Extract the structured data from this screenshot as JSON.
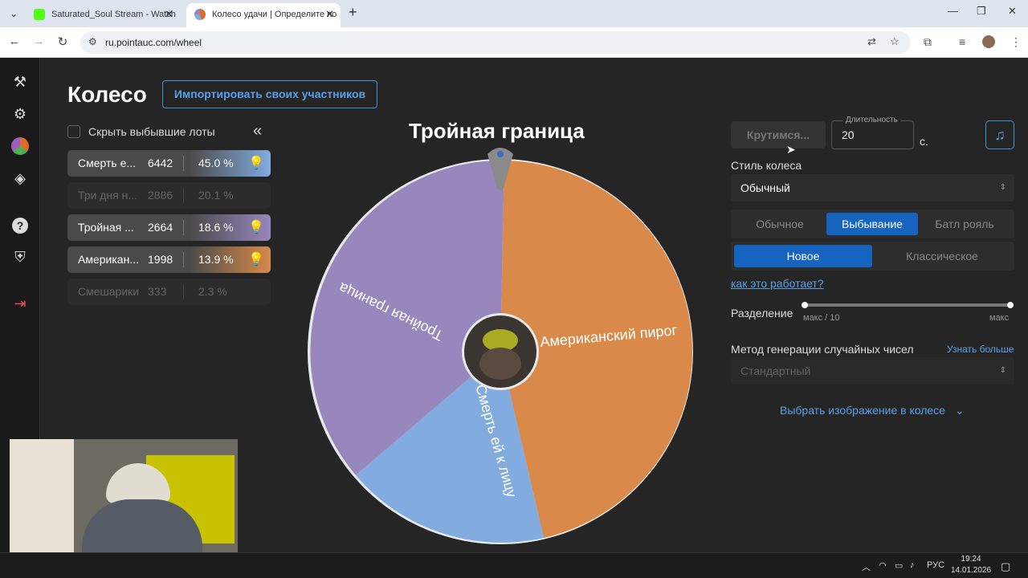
{
  "browser": {
    "tabs": [
      {
        "title": "Saturated_Soul Stream - Watch",
        "favicon_color": "#53fc18"
      },
      {
        "title": "Колесо удачи | Определите по",
        "favicon_color": "#e06a2c"
      }
    ],
    "url": "ru.pointauc.com/wheel"
  },
  "page": {
    "title": "Колесо",
    "import_button": "Импортировать своих участников",
    "hide_lots_label": "Скрыть выбывшие лоты",
    "collapse_icon": "«",
    "lots": [
      {
        "name": "Смерть е...",
        "amount": "6442",
        "percent": "45.0 %",
        "color": "#82abe0",
        "active": true
      },
      {
        "name": "Три дня н...",
        "amount": "2886",
        "percent": "20.1 %",
        "color": "#2c2c2c",
        "active": false
      },
      {
        "name": "Тройная ...",
        "amount": "2664",
        "percent": "18.6 %",
        "color": "#9787bd",
        "active": true
      },
      {
        "name": "Американ...",
        "amount": "1998",
        "percent": "13.9 %",
        "color": "#d98a4a",
        "active": true
      },
      {
        "name": "Смешарики",
        "amount": "333",
        "percent": "2.3 %",
        "color": "#2c2c2c",
        "active": false
      }
    ]
  },
  "wheel": {
    "title": "Тройная граница",
    "segments": [
      {
        "label": "Американский пирог",
        "color": "#d98a4a"
      },
      {
        "label": "Смерть ей к лицу",
        "color": "#82abe0"
      },
      {
        "label": "Тройная граница",
        "color": "#9787bd"
      }
    ]
  },
  "controls": {
    "spin_button": "Крутимся...",
    "duration_label": "Длительность",
    "duration_value": "20",
    "duration_unit": "с.",
    "wheel_style_label": "Стиль колеса",
    "wheel_style_value": "Обычный",
    "modes": [
      "Обычное",
      "Выбывание",
      "Батл рояль"
    ],
    "active_mode": "Выбывание",
    "variants": [
      "Новое",
      "Классическое"
    ],
    "active_variant": "Новое",
    "how_it_works": "как это работает?",
    "split_label": "Разделение",
    "split_min": "макс / 10",
    "split_max": "макс",
    "rng_label": "Метод генерации случайных чисел",
    "rng_more": "Узнать больше",
    "rng_value": "Стандартный",
    "choose_image": "Выбрать изображение в колесе"
  },
  "taskbar": {
    "lang": "РУС",
    "time": "19:24",
    "date": "14.01.2026"
  }
}
